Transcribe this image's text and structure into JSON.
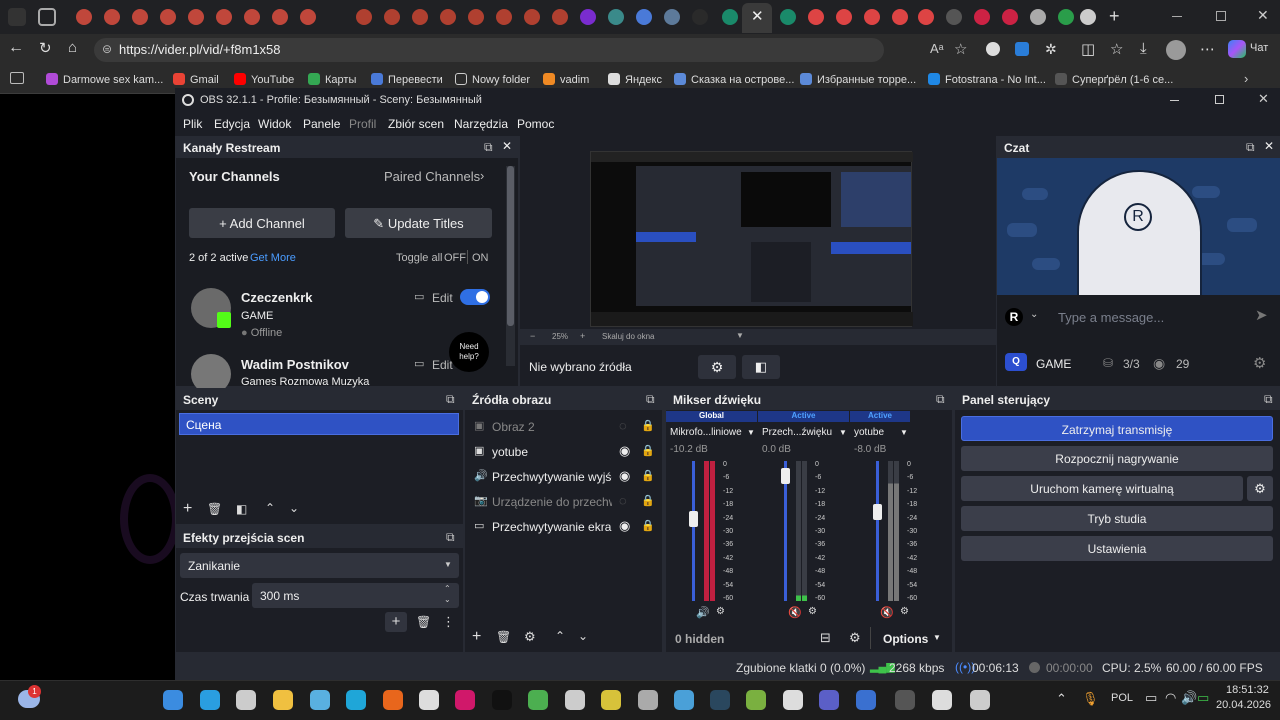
{
  "browser": {
    "url": "https://vider.pl/vid/+f8m1x58",
    "chat_label": "Чат",
    "bookmarks": [
      "Darmowe sex kam...",
      "Gmail",
      "YouTube",
      "Карты",
      "Перевести",
      "Nowy folder",
      "vadim",
      "Яндекс",
      "Сказка на острове...",
      "Избранные торре...",
      "Fotostrana - No Int...",
      "Суперґрёл (1-6 се..."
    ]
  },
  "obs": {
    "title": "OBS 32.1.1 - Profile: Безымянный - Sceny: Безымянный",
    "menu": [
      "Plik",
      "Edycja",
      "Widok",
      "Panele",
      "Profil",
      "Zbiór scen",
      "Narzędzia",
      "Pomoc"
    ],
    "restream": {
      "title": "Kanały Restream",
      "your_channels": "Your Channels",
      "paired_channels": "Paired Channels",
      "add_channel": "Add Channel",
      "update_titles": "Update Titles",
      "active_count": "2 of 2 active",
      "get_more": "Get More",
      "toggle_all": "Toggle all",
      "off": "OFF",
      "on": "ON",
      "channels": [
        {
          "name": "Czeczenkrk",
          "category": "GAME",
          "status": "Offline",
          "edit": "Edit"
        },
        {
          "name": "Wadim Postnikov",
          "category": "Games Rozmowa Muzyka",
          "edit": "Edit"
        }
      ],
      "need_help": "Need help?"
    },
    "preview": {
      "zoom": "25%",
      "fit": "Skaluj do okna",
      "no_source": "Nie wybrano źródła"
    },
    "chat": {
      "title": "Czat",
      "placeholder": "Type a message...",
      "game_label": "GAME",
      "count": "3/3",
      "viewers": "29"
    },
    "scenes": {
      "title": "Sceny",
      "items": [
        "Сцена"
      ]
    },
    "sources": {
      "title": "Źródła obrazu",
      "items": [
        "Obraz 2",
        "yotube",
        "Przechwytywanie wyjści",
        "Urządzenie do przechwy",
        "Przechwytywanie ekranu"
      ]
    },
    "mixer": {
      "title": "Mikser dźwięku",
      "channels": [
        {
          "tag": "Global",
          "name": "Mikrofo...liniowe",
          "db": "-10.2 dB"
        },
        {
          "tag": "Active",
          "name": "Przech...źwięku",
          "db": "0.0 dB"
        },
        {
          "tag": "Active",
          "name": "yotube",
          "db": "-8.0 dB"
        }
      ],
      "scale": [
        "0",
        "-6",
        "-12",
        "-18",
        "-24",
        "-30",
        "-36",
        "-42",
        "-48",
        "-54",
        "-60"
      ],
      "hidden": "0 hidden",
      "options": "Options"
    },
    "transitions": {
      "title": "Efekty przejścia scen",
      "effect": "Zanikanie",
      "duration_label": "Czas trwania",
      "duration_value": "300 ms"
    },
    "controls": {
      "title": "Panel sterujący",
      "buttons": [
        "Zatrzymaj transmisję",
        "Rozpocznij nagrywanie",
        "Uruchom kamerę wirtualną",
        "Tryb studia",
        "Ustawienia"
      ]
    },
    "status": {
      "dropped": "Zgubione klatki 0 (0.0%)",
      "bitrate": "2268 kbps",
      "stream_time": "00:06:13",
      "rec_time": "00:00:00",
      "cpu": "CPU: 2.5%",
      "fps": "60.00 / 60.00 FPS"
    }
  },
  "taskbar": {
    "lang": "POL",
    "time": "18:51:32",
    "date": "20.04.2026",
    "badge": "1"
  }
}
